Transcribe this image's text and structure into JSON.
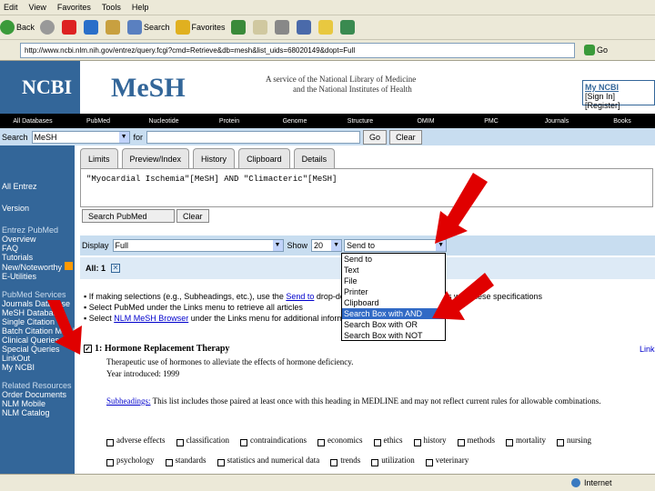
{
  "menubar": {
    "items": [
      "Edit",
      "View",
      "Favorites",
      "Tools",
      "Help"
    ]
  },
  "toolbar": {
    "back": "Back",
    "search": "Search",
    "favorites": "Favorites"
  },
  "address": {
    "url": "http://www.ncbi.nlm.nih.gov/entrez/query.fcgi?cmd=Retrieve&db=mesh&list_uids=68020149&dopt=Full",
    "go": "Go"
  },
  "header": {
    "ncbi": "NCBI",
    "mesh": "MeSH",
    "tagline1": "A service of the National Library of Medicine",
    "tagline2": "and the National Institutes of Health",
    "my_ncbi": "My NCBI",
    "signin": "[Sign In] [Register]"
  },
  "nav": [
    "All Databases",
    "PubMed",
    "Nucleotide",
    "Protein",
    "Genome",
    "Structure",
    "OMIM",
    "PMC",
    "Journals",
    "Books"
  ],
  "search": {
    "label": "Search",
    "db": "MeSH",
    "for": "for",
    "go": "Go",
    "clear": "Clear"
  },
  "tabs": [
    "Limits",
    "Preview/Index",
    "History",
    "Clipboard",
    "Details"
  ],
  "query": "\"Myocardial Ischemia\"[MeSH] AND \"Climacteric\"[MeSH]",
  "search_pubmed": "Search PubMed",
  "clear_btn": "Clear",
  "display": {
    "label": "Display",
    "value": "Full",
    "show_label": "Show",
    "show_value": "20",
    "send_to": "Send to"
  },
  "all_tab": "All: 1",
  "dropdown": [
    "Send to",
    "Text",
    "File",
    "Printer",
    "Clipboard",
    "Search Box with AND",
    "Search Box with OR",
    "Search Box with NOT"
  ],
  "sidebar": [
    "All Entrez",
    "Version",
    "Entrez PubMed",
    "Overview",
    "FAQ",
    "Tutorials",
    "New/Noteworthy",
    "E-Utilities",
    "PubMed Services",
    "Journals Database",
    "MeSH Database",
    "Single Citation",
    "Batch Citation Matcher",
    "Clinical Queries",
    "Special Queries",
    "LinkOut",
    "My NCBI",
    "Related Resources",
    "Order Documents",
    "NLM Mobile",
    "NLM Catalog"
  ],
  "bullets": [
    {
      "pre": "If making selections (e.g., Subheadings, etc.), use the ",
      "link": "Send to",
      "post": " drop-down to create PubMed records with these specifications"
    },
    {
      "pre": "Select PubMed under the Links menu to retrieve all articles",
      "link": "",
      "post": ""
    },
    {
      "pre": "Select ",
      "link": "NLM MeSH Browser",
      "post": " under the Links menu for additional information"
    }
  ],
  "result": {
    "title": "1: Hormone Replacement Therapy",
    "links": "Links",
    "desc": "Therapeutic use of hormones to alleviate the effects of hormone deficiency.",
    "year": "Year introduced: 1999"
  },
  "subheadings": {
    "link": "Subheadings:",
    "text": " This list includes those paired at least once with this heading in MEDLINE and may not reflect current rules for allowable combinations."
  },
  "checks": [
    "adverse effects",
    "classification",
    "contraindications",
    "economics",
    "ethics",
    "history",
    "methods",
    "mortality",
    "nursing",
    "psychology",
    "standards",
    "statistics and numerical data",
    "trends",
    "utilization",
    "veterinary"
  ],
  "status": {
    "zone": "Internet"
  },
  "colors": {
    "ncbi_blue": "#336699",
    "arrow": "#e00000"
  }
}
